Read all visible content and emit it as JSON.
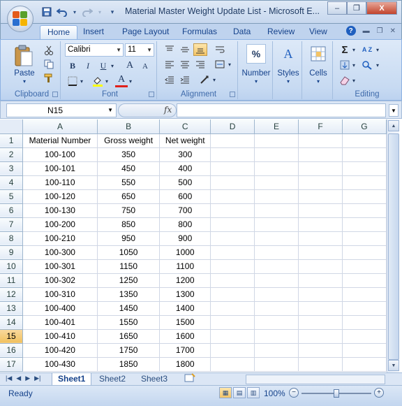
{
  "window": {
    "title": "Material Master Weight Update List - Microsoft E...",
    "minimize": "–",
    "restore": "❐",
    "close": "X"
  },
  "qat": {
    "save_icon": "save-icon",
    "undo_icon": "undo-icon",
    "redo_icon": "redo-icon",
    "customize_icon": "customize-icon"
  },
  "tabs": [
    "Home",
    "Insert",
    "Page Layout",
    "Formulas",
    "Data",
    "Review",
    "View"
  ],
  "ribbon": {
    "clipboard": {
      "label": "Clipboard",
      "paste": "Paste"
    },
    "font": {
      "label": "Font",
      "name": "Calibri",
      "size": "11",
      "bold": "B",
      "italic": "I",
      "underline": "U",
      "grow": "A",
      "shrink": "A",
      "font_color_glyph": "A"
    },
    "alignment": {
      "label": "Alignment"
    },
    "number": {
      "label": "Number",
      "glyph": "%"
    },
    "styles": {
      "label": "Styles",
      "glyph": "A"
    },
    "cells": {
      "label": "Cells"
    },
    "editing": {
      "label": "Editing",
      "sum_glyph": "Σ",
      "sort_glyph": "A Z"
    }
  },
  "formula_bar": {
    "name_box": "N15",
    "fx": "fx",
    "formula": ""
  },
  "grid": {
    "columns": [
      "A",
      "B",
      "C",
      "D",
      "E",
      "F",
      "G"
    ],
    "rows": [
      {
        "n": "1",
        "a": "Material Number",
        "b": "Gross weight",
        "c": "Net weight"
      },
      {
        "n": "2",
        "a": "100-100",
        "b": "350",
        "c": "300"
      },
      {
        "n": "3",
        "a": "100-101",
        "b": "450",
        "c": "400"
      },
      {
        "n": "4",
        "a": "100-110",
        "b": "550",
        "c": "500"
      },
      {
        "n": "5",
        "a": "100-120",
        "b": "650",
        "c": "600"
      },
      {
        "n": "6",
        "a": "100-130",
        "b": "750",
        "c": "700"
      },
      {
        "n": "7",
        "a": "100-200",
        "b": "850",
        "c": "800"
      },
      {
        "n": "8",
        "a": "100-210",
        "b": "950",
        "c": "900"
      },
      {
        "n": "9",
        "a": "100-300",
        "b": "1050",
        "c": "1000"
      },
      {
        "n": "10",
        "a": "100-301",
        "b": "1150",
        "c": "1100"
      },
      {
        "n": "11",
        "a": "100-302",
        "b": "1250",
        "c": "1200"
      },
      {
        "n": "12",
        "a": "100-310",
        "b": "1350",
        "c": "1300"
      },
      {
        "n": "13",
        "a": "100-400",
        "b": "1450",
        "c": "1400"
      },
      {
        "n": "14",
        "a": "100-401",
        "b": "1550",
        "c": "1500"
      },
      {
        "n": "15",
        "a": "100-410",
        "b": "1650",
        "c": "1600"
      },
      {
        "n": "16",
        "a": "100-420",
        "b": "1750",
        "c": "1700"
      },
      {
        "n": "17",
        "a": "100-430",
        "b": "1850",
        "c": "1800"
      }
    ],
    "selected_row": "15"
  },
  "sheets": [
    "Sheet1",
    "Sheet2",
    "Sheet3"
  ],
  "status": {
    "ready": "Ready",
    "zoom": "100%",
    "zoom_minus": "−",
    "zoom_plus": "+"
  }
}
